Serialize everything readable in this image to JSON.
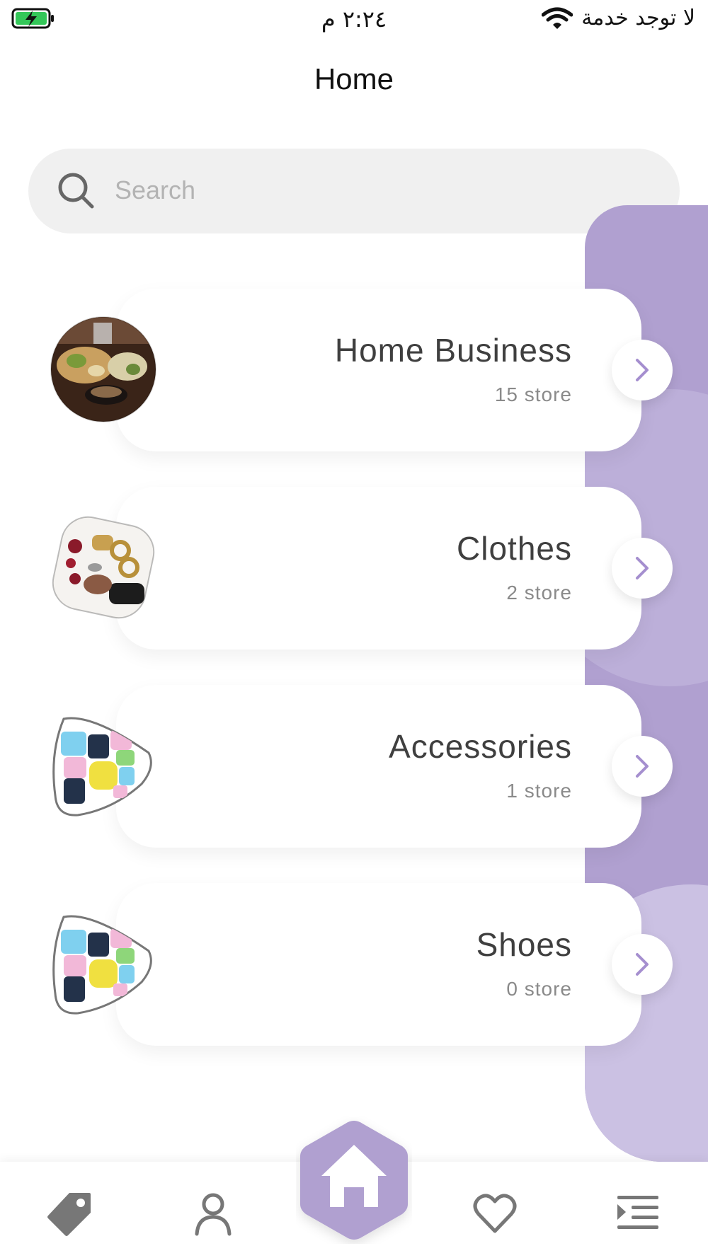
{
  "status_bar": {
    "time": "٢:٢٤ م",
    "carrier": "لا توجد خدمة",
    "icons": [
      "battery-charging-icon",
      "wifi-icon"
    ]
  },
  "header": {
    "title": "Home"
  },
  "search": {
    "placeholder": "Search"
  },
  "categories": [
    {
      "name": "Home Business",
      "count": "15 store",
      "thumb": "food-plate-image"
    },
    {
      "name": "Clothes",
      "count": "2 store",
      "thumb": "accessories-collage-image"
    },
    {
      "name": "Accessories",
      "count": "1 store",
      "thumb": "clothes-collage-image"
    },
    {
      "name": "Shoes",
      "count": "0 store",
      "thumb": "clothes-collage-image"
    }
  ],
  "bottom_nav": {
    "items": [
      "tag-icon",
      "profile-icon",
      "home-icon",
      "heart-icon",
      "menu-icon"
    ],
    "active": "home-icon"
  },
  "colors": {
    "accent": "#b0a0d0",
    "accent_light": "#cbc1e3",
    "battery_green": "#34c759",
    "icon_gray": "#777777"
  }
}
